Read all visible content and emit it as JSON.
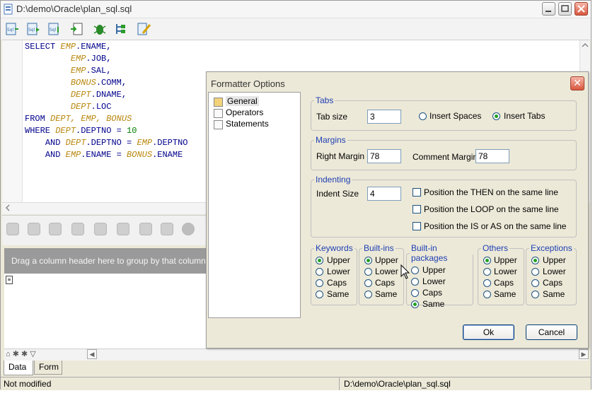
{
  "window": {
    "title": "D:\\demo\\Oracle\\plan_sql.sql"
  },
  "editor": {
    "lines": [
      {
        "k1": "SELECT ",
        "v1": "EMP",
        "t1": ".ENAME,"
      },
      {
        "pad": "         ",
        "v1": "EMP",
        "t1": ".JOB,"
      },
      {
        "pad": "         ",
        "v1": "EMP",
        "t1": ".SAL,"
      },
      {
        "pad": "         ",
        "v1": "BONUS",
        "t1": ".COMM,"
      },
      {
        "pad": "         ",
        "v1": "DEPT",
        "t1": ".DNAME,"
      },
      {
        "pad": "         ",
        "v1": "DEPT",
        "t1": ".LOC"
      },
      {
        "k1": "FROM ",
        "v1": "DEPT, EMP, BONUS"
      },
      {
        "k1": "WHERE ",
        "v1": "DEPT",
        "t1": ".DEPTNO = ",
        "n1": "10"
      },
      {
        "pad": "    ",
        "k1": "AND ",
        "v1": "DEPT",
        "t1": ".DEPTNO = ",
        "v2": "EMP",
        "t2": ".DEPTNO"
      },
      {
        "pad": "    ",
        "k1": "AND ",
        "v1": "EMP",
        "t1": ".ENAME = ",
        "v2": "BONUS",
        "t2": ".ENAME"
      }
    ]
  },
  "grid": {
    "group_hint": "Drag a column header here to group by that column",
    "tabs": [
      "Data",
      "Form"
    ]
  },
  "status": {
    "left": "Not modified",
    "right": "D:\\demo\\Oracle\\plan_sql.sql"
  },
  "dialog": {
    "title": "Formatter Options",
    "tree": [
      "General",
      "Operators",
      "Statements"
    ],
    "tabs_group": {
      "legend": "Tabs",
      "tab_size_label": "Tab size",
      "tab_size_value": "3",
      "insert_spaces": "Insert Spaces",
      "insert_tabs": "Insert Tabs",
      "selected": "Insert Tabs"
    },
    "margins": {
      "legend": "Margins",
      "right_label": "Right Margin",
      "right_value": "78",
      "comment_label": "Comment Margin",
      "comment_value": "78"
    },
    "indenting": {
      "legend": "Indenting",
      "indent_label": "Indent Size",
      "indent_value": "4",
      "checks": [
        "Position the THEN on the same line",
        "Position the LOOP on the same line",
        "Position the IS or AS on the same line"
      ]
    },
    "case_groups": [
      {
        "legend": "Keywords",
        "options": [
          "Upper",
          "Lower",
          "Caps",
          "Same"
        ],
        "selected": 0
      },
      {
        "legend": "Built-ins",
        "options": [
          "Upper",
          "Lower",
          "Caps",
          "Same"
        ],
        "selected": 0
      },
      {
        "legend": "Built-in packages",
        "options": [
          "Upper",
          "Lower",
          "Caps",
          "Same"
        ],
        "selected": 3
      },
      {
        "legend": "Others",
        "options": [
          "Upper",
          "Lower",
          "Caps",
          "Same"
        ],
        "selected": 0
      },
      {
        "legend": "Exceptions",
        "options": [
          "Upper",
          "Lower",
          "Caps",
          "Same"
        ],
        "selected": 0
      }
    ],
    "ok": "Ok",
    "cancel": "Cancel"
  },
  "colors": {
    "legend": "#1f3fb3",
    "keyword": "#00008b",
    "identifier": "#b8860b",
    "number": "#008000"
  }
}
